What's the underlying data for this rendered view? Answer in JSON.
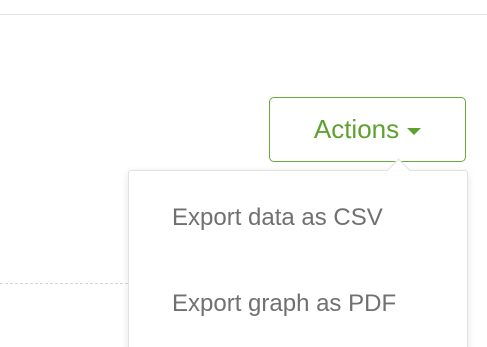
{
  "actions": {
    "label": "Actions",
    "caret_icon": "caret-down-icon",
    "accent_color": "#5ea131"
  },
  "menu": {
    "items": [
      {
        "label": "Export data as CSV"
      },
      {
        "label": "Export graph as PDF"
      }
    ]
  }
}
